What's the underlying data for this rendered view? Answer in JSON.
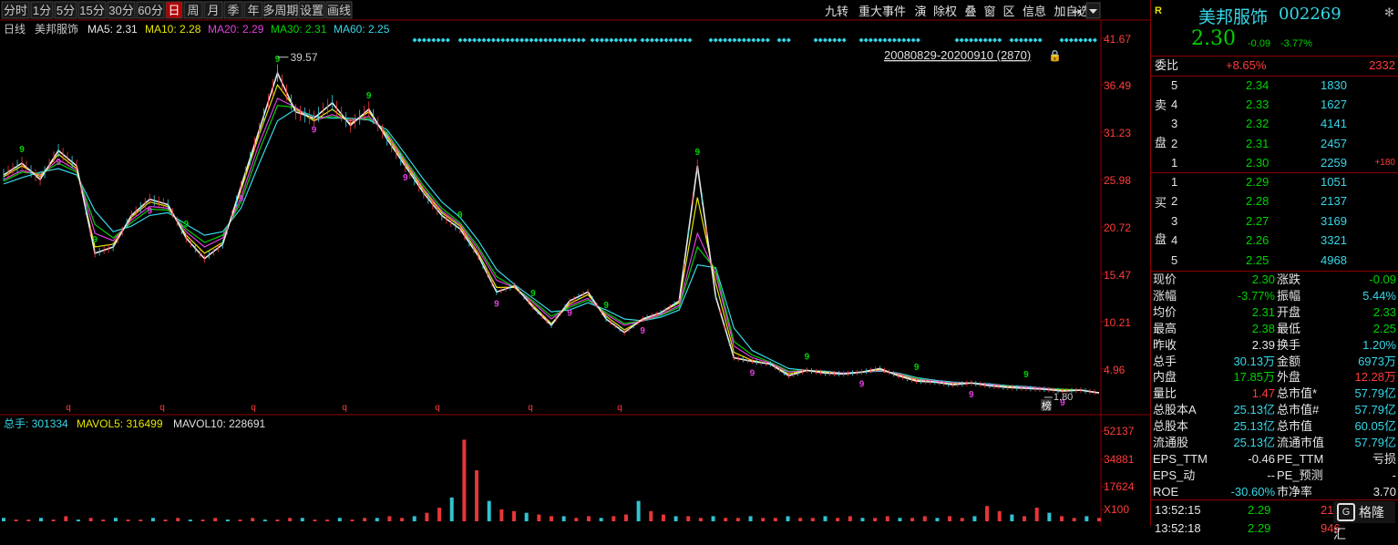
{
  "toolbar": {
    "periods": [
      "分时",
      "1分",
      "5分",
      "15分",
      "30分",
      "60分",
      "日",
      "周",
      "月",
      "季",
      "年",
      "多周期",
      "设置",
      "画线"
    ],
    "active_period": "日",
    "right_buttons": [
      "九转",
      "重大事件",
      "演",
      "除权",
      "叠",
      "窗",
      "区",
      "信息",
      "加自选"
    ]
  },
  "main_legend": {
    "label1": "日线",
    "label2": "美邦服饰",
    "ma5": "MA5: 2.31",
    "ma10": "MA10: 2.28",
    "ma20": "MA20: 2.29",
    "ma30": "MA30: 2.31",
    "ma60": "MA60: 2.25"
  },
  "date_range": "20080829-20200910 (2870)",
  "high_label": "39.57",
  "low_label": "1.80",
  "flag_label": "榜",
  "volume_legend": {
    "total": "总手: 301334",
    "mavol5": "MAVOL5: 316499",
    "mavol10": "MAVOL10: 228691"
  },
  "colors": {
    "ma5": "#e8e8e8",
    "ma10": "#e6e600",
    "ma20": "#e040e0",
    "ma30": "#00d200",
    "ma60": "#36d8e8",
    "up": "#ff3c3c",
    "down": "#36d8e8",
    "grid": "#8b0000"
  },
  "chart_data": {
    "type": "line",
    "x_range": [
      "20080829",
      "20200910"
    ],
    "x_count": 2870,
    "ylim": [
      1.8,
      41.67
    ],
    "y_ticks": [
      "41.67",
      "36.49",
      "31.23",
      "25.98",
      "20.72",
      "15.47",
      "10.21",
      "4.96"
    ],
    "series": [
      {
        "name": "MA5",
        "values": [
          26.5,
          27.8,
          26.0,
          29.2,
          27.5,
          17.8,
          18.5,
          22.0,
          23.8,
          23.2,
          19.5,
          17.2,
          18.8,
          25.2,
          31.5,
          37.8,
          33.5,
          32.8,
          34.5,
          32.0,
          33.8,
          30.5,
          27.5,
          24.5,
          22.0,
          20.5,
          17.5,
          13.5,
          14.2,
          11.8,
          9.8,
          12.5,
          13.5,
          10.5,
          9.0,
          10.5,
          11.2,
          12.5,
          27.5,
          13.0,
          6.2,
          5.8,
          5.5,
          4.2,
          4.8,
          4.5,
          4.4,
          4.6,
          5.0,
          4.2,
          3.6,
          3.5,
          3.2,
          3.4,
          3.1,
          2.9,
          2.8,
          2.7,
          2.5,
          2.6,
          2.3
        ]
      },
      {
        "name": "MA10",
        "values": [
          26.3,
          27.5,
          26.3,
          28.8,
          27.2,
          18.5,
          18.8,
          21.8,
          23.5,
          23.0,
          19.8,
          17.8,
          19.0,
          24.8,
          31.0,
          36.5,
          33.8,
          32.5,
          33.8,
          32.2,
          33.5,
          30.8,
          27.8,
          24.8,
          22.3,
          20.8,
          17.8,
          14.0,
          14.0,
          12.0,
          10.0,
          12.2,
          13.2,
          10.8,
          9.3,
          10.4,
          11.2,
          12.3,
          24.0,
          14.5,
          6.8,
          5.9,
          5.5,
          4.4,
          4.8,
          4.6,
          4.4,
          4.6,
          4.9,
          4.3,
          3.7,
          3.5,
          3.3,
          3.4,
          3.1,
          3.0,
          2.8,
          2.7,
          2.6,
          2.6,
          2.3
        ]
      },
      {
        "name": "MA20",
        "values": [
          26.0,
          27.0,
          26.5,
          28.2,
          27.0,
          20.0,
          19.2,
          21.5,
          23.0,
          22.8,
          20.2,
          18.5,
          19.5,
          24.0,
          30.0,
          35.0,
          34.0,
          32.5,
          33.2,
          32.5,
          33.0,
          31.0,
          28.0,
          25.0,
          22.5,
          21.0,
          18.2,
          14.8,
          14.0,
          12.3,
          10.5,
          12.0,
          12.8,
          11.0,
          9.8,
          10.3,
          11.0,
          12.0,
          20.0,
          15.5,
          7.5,
          6.2,
          5.6,
          4.6,
          4.8,
          4.6,
          4.5,
          4.6,
          4.8,
          4.4,
          3.8,
          3.6,
          3.4,
          3.4,
          3.2,
          3.0,
          2.9,
          2.8,
          2.6,
          2.6,
          2.3
        ]
      },
      {
        "name": "MA30",
        "values": [
          25.8,
          26.8,
          26.6,
          27.8,
          26.8,
          21.0,
          19.5,
          21.2,
          22.7,
          22.6,
          20.5,
          19.0,
          19.8,
          23.5,
          29.2,
          34.2,
          34.0,
          32.6,
          33.0,
          32.6,
          32.8,
          31.2,
          28.2,
          25.3,
          22.8,
          21.2,
          18.5,
          15.2,
          14.0,
          12.5,
          10.8,
          11.8,
          12.6,
          11.2,
          10.0,
          10.3,
          10.9,
          11.8,
          18.5,
          16.0,
          8.0,
          6.5,
          5.7,
          4.7,
          4.8,
          4.6,
          4.5,
          4.6,
          4.8,
          4.4,
          3.9,
          3.6,
          3.4,
          3.4,
          3.2,
          3.0,
          2.9,
          2.8,
          2.7,
          2.6,
          2.3
        ]
      },
      {
        "name": "MA60",
        "values": [
          25.5,
          26.2,
          26.8,
          27.2,
          26.5,
          22.5,
          20.2,
          20.8,
          22.0,
          22.3,
          21.0,
          19.8,
          20.2,
          22.8,
          27.8,
          32.5,
          33.8,
          33.0,
          32.8,
          32.8,
          32.6,
          31.5,
          28.8,
          26.0,
          23.5,
          21.8,
          19.2,
          16.0,
          14.3,
          12.8,
          11.3,
          11.5,
          12.3,
          11.5,
          10.5,
          10.3,
          10.7,
          11.5,
          16.5,
          16.2,
          9.5,
          7.0,
          6.0,
          5.0,
          4.8,
          4.7,
          4.5,
          4.6,
          4.7,
          4.5,
          4.0,
          3.7,
          3.5,
          3.4,
          3.3,
          3.1,
          3.0,
          2.8,
          2.7,
          2.6,
          2.3
        ]
      }
    ],
    "volume": {
      "y_ticks": [
        "52137",
        "34881",
        "17624",
        "X100"
      ],
      "values": [
        2,
        1,
        1,
        2,
        1,
        3,
        1,
        2,
        1,
        2,
        1,
        1,
        2,
        1,
        2,
        1,
        1,
        2,
        1,
        1,
        2,
        1,
        1,
        2,
        2,
        1,
        1,
        2,
        1,
        2,
        2,
        3,
        2,
        3,
        5,
        8,
        14,
        48,
        30,
        12,
        7,
        6,
        5,
        4,
        3,
        3,
        2,
        3,
        2,
        3,
        4,
        12,
        6,
        4,
        3,
        3,
        2,
        3,
        2,
        2,
        3,
        2,
        2,
        3,
        2,
        2,
        3,
        2,
        3,
        2,
        2,
        3,
        2,
        2,
        3,
        2,
        3,
        2,
        3,
        9,
        6,
        4,
        3,
        8,
        5,
        3,
        2,
        3,
        2
      ]
    }
  },
  "quote": {
    "icon": "R",
    "name": "美邦服饰",
    "code": "002269",
    "price": "2.30",
    "change": "-0.09",
    "change_pct": "-3.77%",
    "weibi_label": "委比",
    "weibi_value": "+8.65%",
    "weibi_diff": "2332",
    "sell_label": [
      "卖",
      "盘"
    ],
    "buy_label": [
      "买",
      "盘"
    ],
    "asks": [
      {
        "n": "5",
        "price": "2.34",
        "vol": "1830",
        "extra": ""
      },
      {
        "n": "4",
        "price": "2.33",
        "vol": "1627",
        "extra": ""
      },
      {
        "n": "3",
        "price": "2.32",
        "vol": "4141",
        "extra": ""
      },
      {
        "n": "2",
        "price": "2.31",
        "vol": "2457",
        "extra": ""
      },
      {
        "n": "1",
        "price": "2.30",
        "vol": "2259",
        "extra": "+180"
      }
    ],
    "bids": [
      {
        "n": "1",
        "price": "2.29",
        "vol": "1051"
      },
      {
        "n": "2",
        "price": "2.28",
        "vol": "2137"
      },
      {
        "n": "3",
        "price": "2.27",
        "vol": "3169"
      },
      {
        "n": "4",
        "price": "2.26",
        "vol": "3321"
      },
      {
        "n": "5",
        "price": "2.25",
        "vol": "4968"
      }
    ],
    "stats": [
      {
        "l1": "现价",
        "v1": "2.30",
        "c1": "green",
        "l2": "涨跌",
        "v2": "-0.09",
        "c2": "green"
      },
      {
        "l1": "涨幅",
        "v1": "-3.77%",
        "c1": "green",
        "l2": "振幅",
        "v2": "5.44%",
        "c2": "cyan"
      },
      {
        "l1": "均价",
        "v1": "2.31",
        "c1": "green",
        "l2": "开盘",
        "v2": "2.33",
        "c2": "green"
      },
      {
        "l1": "最高",
        "v1": "2.38",
        "c1": "green",
        "l2": "最低",
        "v2": "2.25",
        "c2": "green"
      },
      {
        "l1": "昨收",
        "v1": "2.39",
        "c1": "white",
        "l2": "换手",
        "v2": "1.20%",
        "c2": "cyan"
      },
      {
        "l1": "总手",
        "v1": "30.13万",
        "c1": "cyan",
        "l2": "金额",
        "v2": "6973万",
        "c2": "cyan"
      },
      {
        "l1": "内盘",
        "v1": "17.85万",
        "c1": "green",
        "l2": "外盘",
        "v2": "12.28万",
        "c2": "red"
      },
      {
        "l1": "量比",
        "v1": "1.47",
        "c1": "red",
        "l2": "总市值*",
        "v2": "57.79亿",
        "c2": "cyan"
      },
      {
        "l1": "总股本A",
        "v1": "25.13亿",
        "c1": "cyan",
        "l2": "总市值#",
        "v2": "57.79亿",
        "c2": "cyan"
      },
      {
        "l1": "总股本",
        "v1": "25.13亿",
        "c1": "cyan",
        "l2": "总市值",
        "v2": "60.05亿",
        "c2": "cyan"
      },
      {
        "l1": "流通股",
        "v1": "25.13亿",
        "c1": "cyan",
        "l2": "流通市值",
        "v2": "57.79亿",
        "c2": "cyan"
      },
      {
        "l1": "EPS_TTM",
        "v1": "-0.46",
        "c1": "white",
        "l2": "PE_TTM",
        "v2": "亏损",
        "c2": "white"
      },
      {
        "l1": "EPS_动",
        "v1": "--",
        "c1": "white",
        "l2": "PE_预测",
        "v2": "-",
        "c2": "white"
      },
      {
        "l1": "ROE",
        "v1": "-30.60%",
        "c1": "cyan",
        "l2": "市净率",
        "v2": "3.70",
        "c2": "white"
      }
    ],
    "tick": {
      "time": "13:52:15",
      "price": "2.29",
      "vol": "21"
    },
    "tick2": {
      "time": "13:52:18",
      "price": "2.29",
      "vol": "946"
    },
    "watermark": "格隆汇"
  }
}
